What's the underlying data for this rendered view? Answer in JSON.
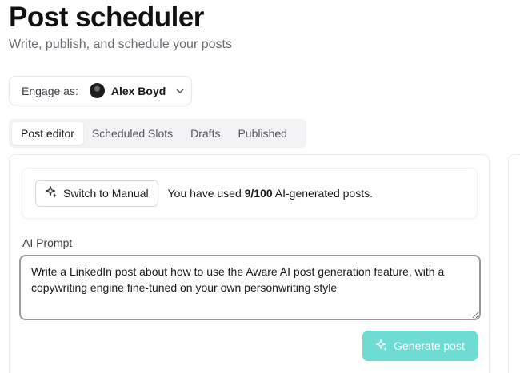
{
  "header": {
    "title": "Post scheduler",
    "subtitle": "Write, publish, and schedule your posts"
  },
  "engage": {
    "label": "Engage as:",
    "selected_name": "Alex Boyd"
  },
  "tabs": [
    {
      "label": "Post editor",
      "active": true
    },
    {
      "label": "Scheduled Slots",
      "active": false
    },
    {
      "label": "Drafts",
      "active": false
    },
    {
      "label": "Published",
      "active": false
    }
  ],
  "usage": {
    "switch_button_label": "Switch to Manual",
    "prefix": "You have used",
    "count": "9/100",
    "suffix": "AI-generated posts."
  },
  "prompt": {
    "label": "AI Prompt",
    "value": "Write a LinkedIn post about how to use the Aware AI post generation feature, with a copywriting engine fine-tuned on your own personwriting style"
  },
  "actions": {
    "generate_label": "Generate post"
  },
  "colors": {
    "accent": "#6fdcd3",
    "tab_bar": "#f3f3f5",
    "border": "#e9e9ec"
  },
  "icons": {
    "sparkle": "sparkles-icon",
    "dropdown": "chevron-down-icon"
  }
}
